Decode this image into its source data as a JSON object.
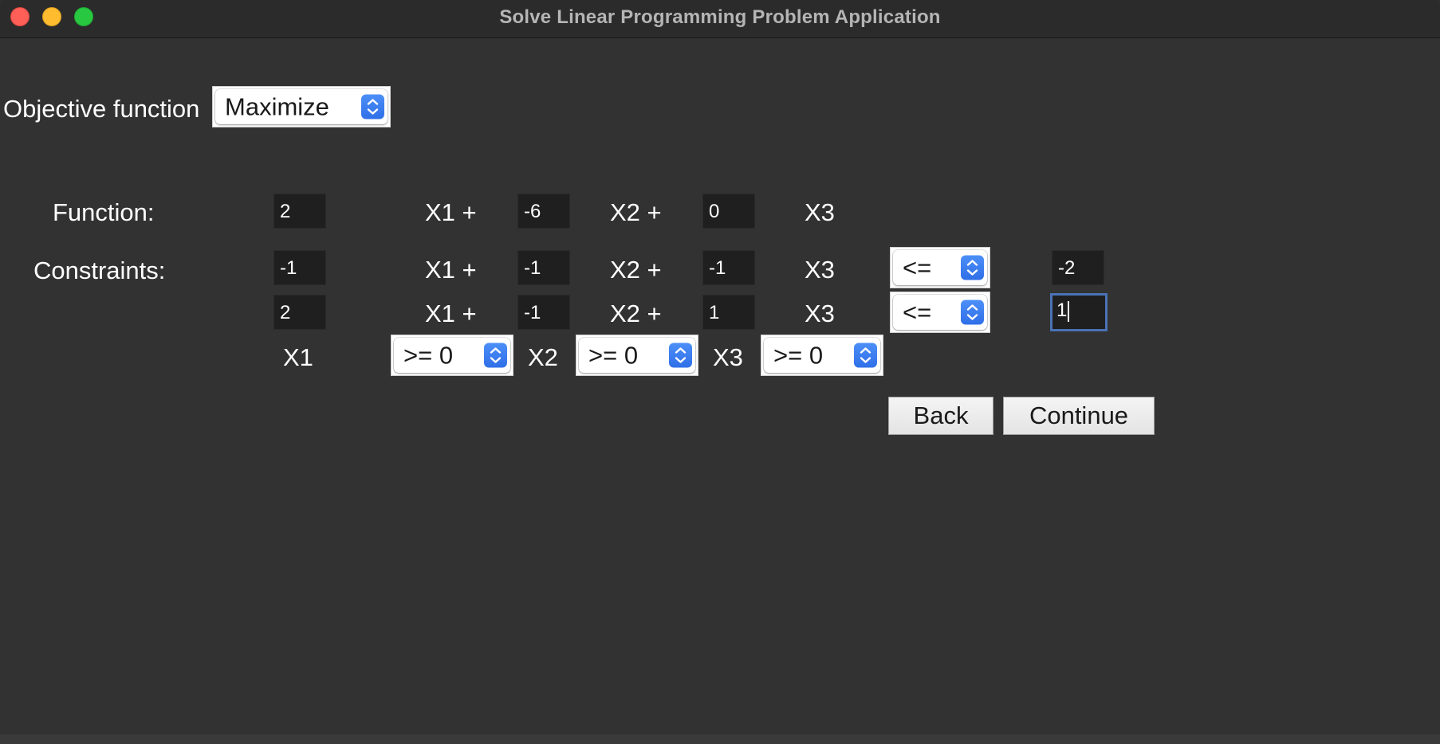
{
  "window": {
    "title": "Solve Linear Programming Problem Application"
  },
  "objective": {
    "label": "Objective function",
    "selected": "Maximize"
  },
  "function_row": {
    "label": "Function:",
    "coefficients": [
      "2",
      "-6",
      "0"
    ],
    "terms": [
      "X1 +",
      "X2 +",
      "X3"
    ]
  },
  "constraints": {
    "label": "Constraints:",
    "rows": [
      {
        "coefficients": [
          "-1",
          "-1",
          "-1"
        ],
        "terms": [
          "X1 +",
          "X2 +",
          "X3"
        ],
        "operator": "<=",
        "rhs": "-2"
      },
      {
        "coefficients": [
          "2",
          "-1",
          "1"
        ],
        "terms": [
          "X1 +",
          "X2 +",
          "X3"
        ],
        "operator": "<=",
        "rhs": "1"
      }
    ]
  },
  "sign_constraints": [
    {
      "variable": "X1",
      "selected": ">= 0"
    },
    {
      "variable": "X2",
      "selected": ">= 0"
    },
    {
      "variable": "X3",
      "selected": ">= 0"
    }
  ],
  "buttons": {
    "back": "Back",
    "continue": "Continue"
  },
  "colors": {
    "background": "#323232",
    "field_background": "#1f1f1f",
    "stepper_blue": "#3478f6",
    "focus_ring": "#4a72b5"
  },
  "icons": {
    "select_stepper": "up-down-chevron-icon"
  }
}
